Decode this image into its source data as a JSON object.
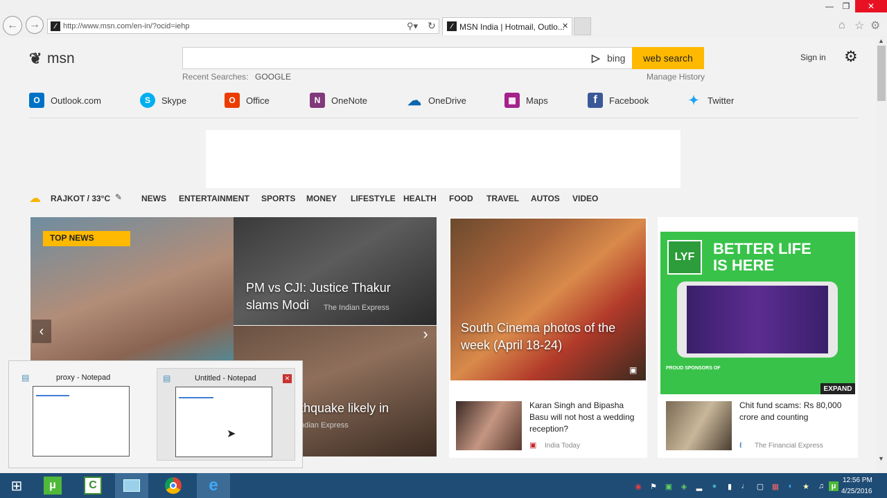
{
  "browser": {
    "address": "http://www.msn.com/en-in/?ocid=iehp",
    "tab_title": "MSN India | Hotmail, Outlo...",
    "tab_close": "✕",
    "back_icon": "back-arrow-icon",
    "forward_icon": "forward-arrow-icon"
  },
  "header": {
    "logo_text": "msn",
    "bing_label": "bing",
    "search_button": "web search",
    "recent_label": "Recent Searches:",
    "recent_item": "GOOGLE",
    "manage_history": "Manage History",
    "sign_in": "Sign in"
  },
  "apps": [
    {
      "label": "Outlook.com",
      "color": "#0072c6",
      "glyph": "O"
    },
    {
      "label": "Skype",
      "color": "#00aff0",
      "glyph": "S"
    },
    {
      "label": "Office",
      "color": "#eb3c00",
      "glyph": "O"
    },
    {
      "label": "OneNote",
      "color": "#80397b",
      "glyph": "N"
    },
    {
      "label": "OneDrive",
      "color": "#0a64ad",
      "glyph": "☁"
    },
    {
      "label": "Maps",
      "color": "#a5228c",
      "glyph": "▦"
    },
    {
      "label": "Facebook",
      "color": "#3b5998",
      "glyph": "f"
    },
    {
      "label": "Twitter",
      "color": "#1da1f2",
      "glyph": "✦"
    }
  ],
  "weather": "RAJKOT / 33°C",
  "nav": [
    "NEWS",
    "ENTERTAINMENT",
    "SPORTS",
    "MONEY",
    "LIFESTYLE",
    "HEALTH",
    "FOOD",
    "TRAVEL",
    "AUTOS",
    "VIDEO"
  ],
  "hero": {
    "badge": "TOP NEWS",
    "story1_title": "PM vs CJI: Justice Thakur slams Modi",
    "story1_source": "The Indian Express",
    "story2_title": "thquake likely in",
    "story2_source": "ndian Express"
  },
  "cinema": {
    "title": "South Cinema photos of the week (April 18-24)"
  },
  "ad": {
    "brand": "LYF",
    "headline_line1": "BETTER LIFE",
    "headline_line2": "IS HERE",
    "sponsor": "PROUD SPONSORS OF",
    "expand": "EXPAND"
  },
  "cards": [
    {
      "title": "Karan Singh and Bipasha Basu will not host a wedding reception?",
      "source": "India Today"
    },
    {
      "title": "Chit fund scams: Rs 80,000 crore and counting",
      "source": "The Financial Express"
    }
  ],
  "thumbnails": [
    {
      "title": "proxy - Notepad"
    },
    {
      "title": "Untitled - Notepad"
    }
  ],
  "taskbar": {
    "time": "12:56 PM",
    "date": "4/25/2016"
  },
  "colors": {
    "accent": "#ffb900",
    "ad_green": "#39c24a",
    "taskbar": "#1f4c74"
  }
}
